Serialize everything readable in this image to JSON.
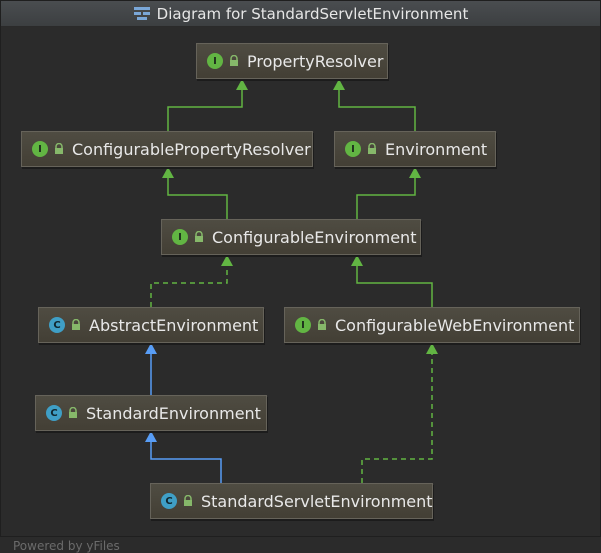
{
  "window": {
    "title": "Diagram for StandardServletEnvironment",
    "watermark": "Powered by yFiles"
  },
  "nodes": {
    "property_resolver": {
      "kind_letter": "I",
      "label": "PropertyResolver"
    },
    "configurable_property_resolver": {
      "kind_letter": "I",
      "label": "ConfigurablePropertyResolver"
    },
    "environment": {
      "kind_letter": "I",
      "label": "Environment"
    },
    "configurable_environment": {
      "kind_letter": "I",
      "label": "ConfigurableEnvironment"
    },
    "abstract_environment": {
      "kind_letter": "C",
      "label": "AbstractEnvironment"
    },
    "configurable_web_environment": {
      "kind_letter": "I",
      "label": "ConfigurableWebEnvironment"
    },
    "standard_environment": {
      "kind_letter": "C",
      "label": "StandardEnvironment"
    },
    "standard_servlet_environment": {
      "kind_letter": "C",
      "label": "StandardServletEnvironment"
    }
  },
  "edges": [
    {
      "from": "configurable_property_resolver",
      "to": "property_resolver",
      "type": "extends-interface"
    },
    {
      "from": "environment",
      "to": "property_resolver",
      "type": "extends-interface"
    },
    {
      "from": "configurable_environment",
      "to": "configurable_property_resolver",
      "type": "extends-interface"
    },
    {
      "from": "configurable_environment",
      "to": "environment",
      "type": "extends-interface"
    },
    {
      "from": "abstract_environment",
      "to": "configurable_environment",
      "type": "implements"
    },
    {
      "from": "configurable_web_environment",
      "to": "configurable_environment",
      "type": "extends-interface"
    },
    {
      "from": "standard_environment",
      "to": "abstract_environment",
      "type": "extends-class"
    },
    {
      "from": "standard_servlet_environment",
      "to": "standard_environment",
      "type": "extends-class"
    },
    {
      "from": "standard_servlet_environment",
      "to": "configurable_web_environment",
      "type": "implements"
    }
  ],
  "colors": {
    "interface_edge": "#62b543",
    "class_edge": "#589df6",
    "interface_badge": "#62b543",
    "class_badge": "#3f9fc6"
  }
}
